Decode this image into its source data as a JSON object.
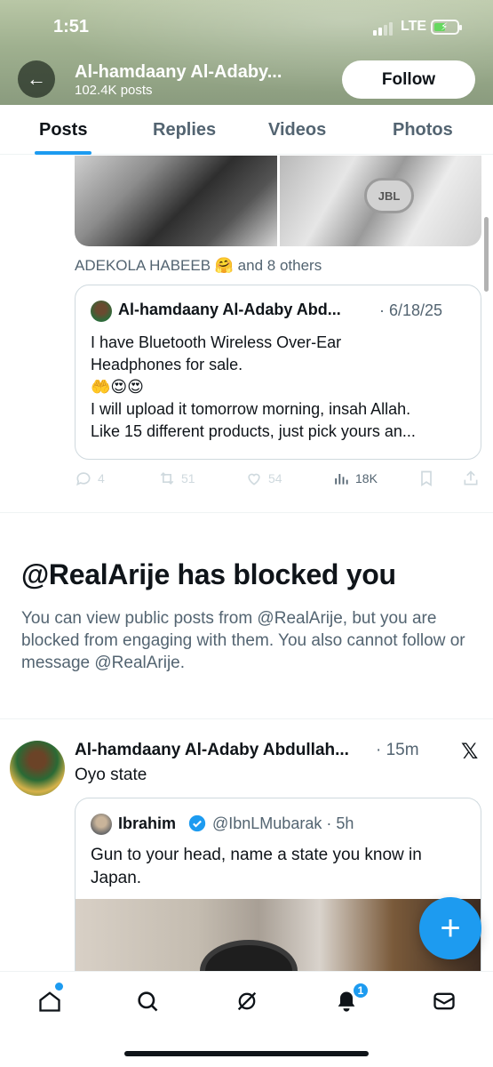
{
  "status_bar": {
    "time": "1:51",
    "network": "LTE"
  },
  "header": {
    "profile_name": "Al-hamdaany Al-Adaby...",
    "post_count": "102.4K posts",
    "follow_label": "Follow"
  },
  "tabs": [
    {
      "label": "Posts",
      "active": true
    },
    {
      "label": "Replies",
      "active": false
    },
    {
      "label": "Videos",
      "active": false
    },
    {
      "label": "Photos",
      "active": false
    }
  ],
  "post1": {
    "media_brand_text": "JBL",
    "liked_by": "ADEKOLA HABEEB 🤗 and 8 others",
    "quote": {
      "author": "Al-hamdaany Al-Adaby Abd...",
      "date": "· 6/18/25",
      "lines": [
        "I have Bluetooth Wireless Over-Ear",
        "Headphones for sale.",
        "🤲😍😍",
        "I will upload it tomorrow morning, insah Allah.",
        "Like 15 different products, just pick yours an..."
      ]
    },
    "actions": {
      "replies": "4",
      "reposts": "51",
      "likes": "54",
      "views": "18K"
    }
  },
  "blocked": {
    "title": "@RealArije has blocked you",
    "description": "You can view public posts from @RealArije, but you are blocked from engaging with them. You also cannot follow or message @RealArije."
  },
  "post2": {
    "author": "Al-hamdaany Al-Adaby Abdullah...",
    "time": "· 15m",
    "text": "Oyo state",
    "quote": {
      "author": "Ibrahim",
      "handle": "@IbnLMubarak · 5h",
      "text": "Gun to your head, name a state you know in Japan."
    }
  },
  "nav": {
    "notifications_badge": "1"
  },
  "colors": {
    "accent": "#1d9bf0",
    "text": "#0f1419",
    "secondary": "#536471"
  }
}
